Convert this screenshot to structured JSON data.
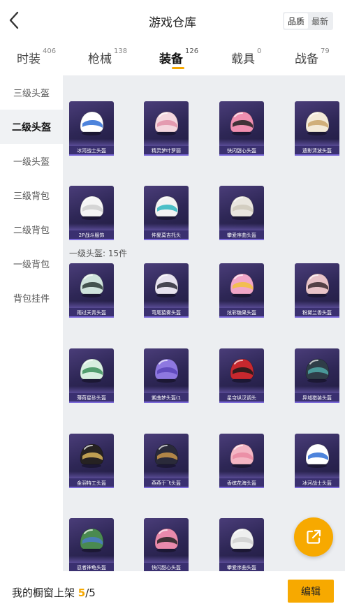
{
  "header": {
    "title": "游戏仓库",
    "sort_options": [
      "品质",
      "最新"
    ],
    "sort_active": "品质"
  },
  "tabs": [
    {
      "label": "时装",
      "count": "406"
    },
    {
      "label": "枪械",
      "count": "138"
    },
    {
      "label": "装备",
      "count": "126",
      "active": true
    },
    {
      "label": "载具",
      "count": "0"
    },
    {
      "label": "战备",
      "count": "79"
    }
  ],
  "sidebar": {
    "items": [
      "三级头盔",
      "二级头盔",
      "一级头盔",
      "三级背包",
      "二级背包",
      "一级背包",
      "背包挂件"
    ],
    "active": "二级头盔"
  },
  "sections": {
    "level2_items": [
      {
        "name": "冰河战士头盔",
        "color": "#ffffff",
        "accent": "#2f6fd6"
      },
      {
        "name": "精灵梦叶罗丽",
        "color": "#f4d6de",
        "accent": "#e090a8"
      },
      {
        "name": "快闪甜心头盔",
        "color": "#f08fb0",
        "accent": "#222222"
      },
      {
        "name": "遗影清波头盔",
        "color": "#f3ead8",
        "accent": "#c9a46a"
      },
      {
        "name": "2P战斗服饰",
        "color": "#f5f5f5",
        "accent": "#cfcfcf"
      },
      {
        "name": "仲夏莫吉托头",
        "color": "#f2f2f2",
        "accent": "#2fb6c0"
      },
      {
        "name": "攀爱序曲头盔",
        "color": "#e9e6df",
        "accent": "#cfc9bc"
      }
    ],
    "level1_label": "一级头盔: 15件",
    "level1_items": [
      {
        "name": "雨过天青头盔",
        "color": "#cfe3dc",
        "accent": "#2a3a35"
      },
      {
        "name": "弯尾猿雾头盔",
        "color": "#e6e2ee",
        "accent": "#2a2a35"
      },
      {
        "name": "炫彩糖果头盔",
        "color": "#f1a6c8",
        "accent": "#f2c23c"
      },
      {
        "name": "粉黛兰香头盔",
        "color": "#e8c3c8",
        "accent": "#3a2a2f"
      },
      {
        "name": "薄荷星砂头盔",
        "color": "#d8efe0",
        "accent": "#3c8f5a"
      },
      {
        "name": "紫曲梦头盔(1",
        "color": "#8e78e0",
        "accent": "#5a44b8"
      },
      {
        "name": "星穹纵汉调头",
        "color": "#c8282e",
        "accent": "#1a1a1a"
      },
      {
        "name": "异域猎装头盔",
        "color": "#2f3d48",
        "accent": "#4fa8a8"
      },
      {
        "name": "金羽特工头盔",
        "color": "#262222",
        "accent": "#d9b45a"
      },
      {
        "name": "燕燕于飞头盔",
        "color": "#2a2a3a",
        "accent": "#c9954a"
      },
      {
        "name": "香槟花海头盔",
        "color": "#f4b6c4",
        "accent": "#e98aa2"
      },
      {
        "name": "冰河战士头盔",
        "color": "#ffffff",
        "accent": "#2f6fd6"
      },
      {
        "name": "忍者神龟头盔",
        "color": "#4a8a50",
        "accent": "#4a7ac8"
      },
      {
        "name": "快闪甜心头盔",
        "color": "#e98aac",
        "accent": "#222222"
      },
      {
        "name": "攀爱序曲头盔",
        "color": "#efefef",
        "accent": "#d0d0d0"
      }
    ]
  },
  "bottom": {
    "window_label": "我的橱窗上架",
    "window_current": "5",
    "window_total": "/5",
    "edit_label": "编辑"
  },
  "colors": {
    "accent": "#f7a900",
    "card_bg": "#2e2756",
    "content_bg": "#eceef1"
  }
}
